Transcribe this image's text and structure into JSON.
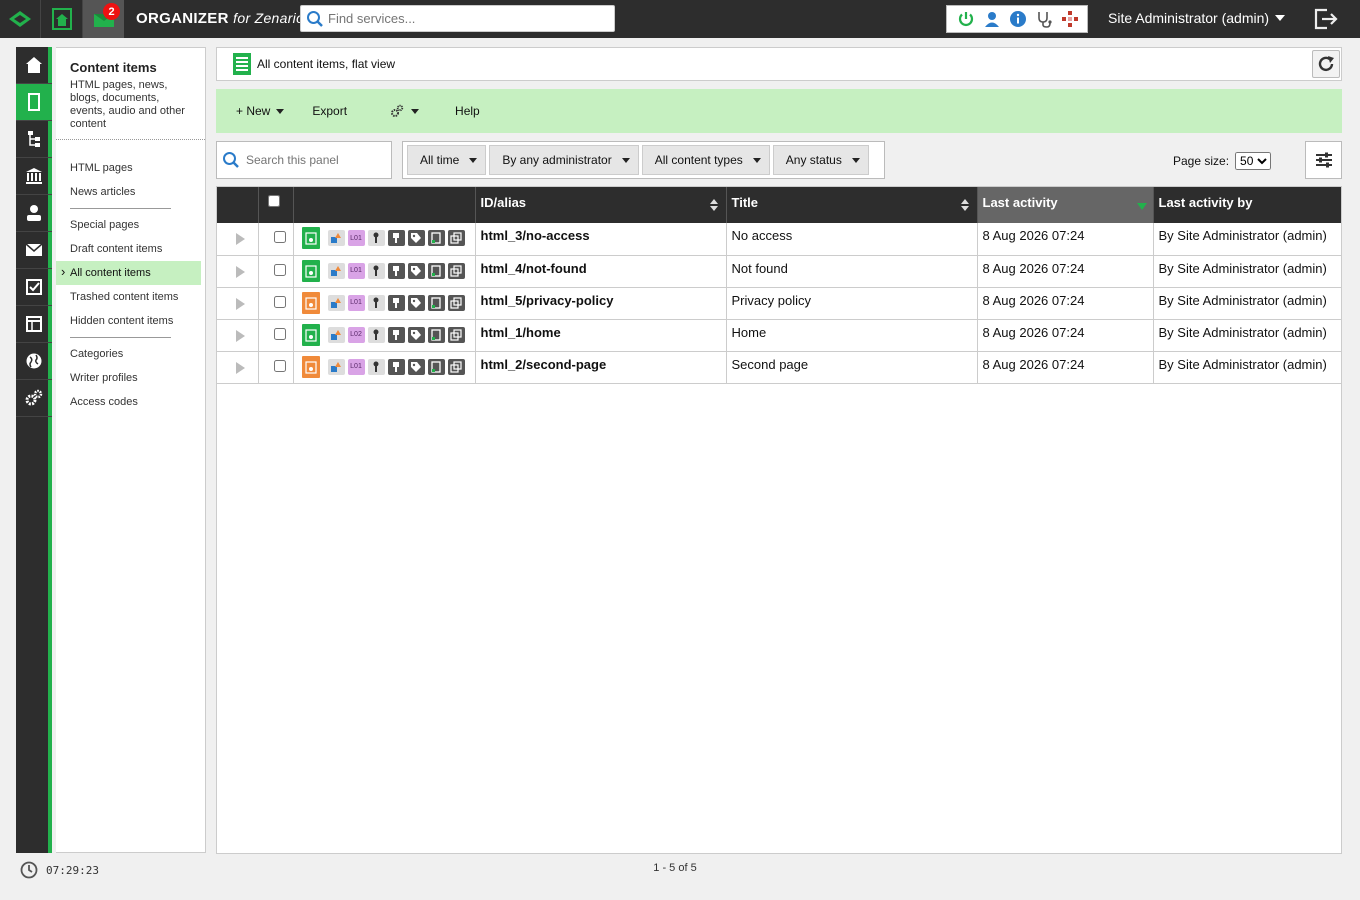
{
  "topbar": {
    "notification_count": "2",
    "brand_main": "ORGANIZER",
    "brand_for": "for Zenario",
    "search_placeholder": "Find services...",
    "admin_label": "Site Administrator (admin)"
  },
  "rail": {
    "items": [
      "home-icon",
      "content-icon",
      "tree-icon",
      "institution-icon",
      "user-icon",
      "envelope-icon",
      "checklist-icon",
      "layout-icon",
      "globe-icon",
      "gears-icon"
    ],
    "active_index": 1
  },
  "nav": {
    "title": "Content items",
    "description": "HTML pages, news, blogs, documents, events, audio and other content",
    "group1": [
      "HTML pages",
      "News articles"
    ],
    "group2": [
      "Special pages",
      "Draft content items",
      "All content items",
      "Trashed content items",
      "Hidden content items"
    ],
    "group3": [
      "Categories",
      "Writer profiles",
      "Access codes"
    ],
    "active_item": "All content items"
  },
  "breadcrumb": {
    "text": "All content items, flat view"
  },
  "toolbar": {
    "new_label": "+ New",
    "export_label": "Export",
    "help_label": "Help"
  },
  "filters": {
    "search_placeholder": "Search this panel",
    "time": "All time",
    "admin": "By any administrator",
    "types": "All content types",
    "status": "Any status",
    "page_size_label": "Page size:",
    "page_size_value": "50",
    "page_size_options": [
      "50"
    ]
  },
  "table": {
    "columns": {
      "alias": "ID/alias",
      "title": "Title",
      "last_activity": "Last activity",
      "last_activity_by": "Last activity by"
    },
    "rows": [
      {
        "alias": "html_3/no-access",
        "title": "No access",
        "last_activity": "8 Aug 2026 07:24",
        "by": "By Site Administrator (admin)",
        "status_color": "#22b14c",
        "layout": "L01"
      },
      {
        "alias": "html_4/not-found",
        "title": "Not found",
        "last_activity": "8 Aug 2026 07:24",
        "by": "By Site Administrator (admin)",
        "status_color": "#22b14c",
        "layout": "L01"
      },
      {
        "alias": "html_5/privacy-policy",
        "title": "Privacy policy",
        "last_activity": "8 Aug 2026 07:24",
        "by": "By Site Administrator (admin)",
        "status_color": "#f08a3a",
        "layout": "L01"
      },
      {
        "alias": "html_1/home",
        "title": "Home",
        "last_activity": "8 Aug 2026 07:24",
        "by": "By Site Administrator (admin)",
        "status_color": "#22b14c",
        "layout": "L02"
      },
      {
        "alias": "html_2/second-page",
        "title": "Second page",
        "last_activity": "8 Aug 2026 07:24",
        "by": "By Site Administrator (admin)",
        "status_color": "#f08a3a",
        "layout": "L01"
      }
    ]
  },
  "footer": {
    "pager": "1 - 5 of 5",
    "clock": "07:29:23"
  },
  "colors": {
    "accent": "#22b14c",
    "accent_light": "#c6f0c1",
    "dark": "#2d2d2d",
    "draft": "#f08a3a"
  }
}
